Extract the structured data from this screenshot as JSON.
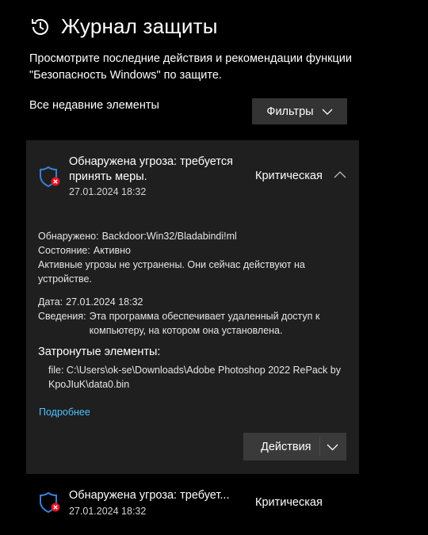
{
  "header": {
    "title": "Журнал защиты",
    "icon": "history-icon"
  },
  "description": "Просмотрите последние действия и рекомендации функции \"Безопасность Windows\" по защите.",
  "section_label": "Все недавние элементы",
  "filters": {
    "label": "Фильтры"
  },
  "threat_card": {
    "title": "Обнаружена угроза: требуется принять меры.",
    "date": "27.01.2024 18:32",
    "severity": "Критическая",
    "icon": "shield-threat-icon",
    "detected_label": "Обнаружено:",
    "detected_value": "Backdoor:Win32/Bladabindi!ml",
    "state_label": "Состояние:",
    "state_value": "Активно",
    "note": "Активные угрозы не устранены. Они сейчас действуют на устройстве.",
    "date_label": "Дата:",
    "date_value": "27.01.2024 18:32",
    "info_label": "Сведения:",
    "info_value": "Эта программа обеспечивает удаленный доступ к компьютеру, на котором она установлена.",
    "affected_heading": "Затронутые элементы:",
    "affected_file": "file: C:\\Users\\ok-se\\Downloads\\Adobe Photoshop 2022 RePack by KpoJIuK\\data0.bin",
    "more_link": "Подробнее",
    "actions_label": "Действия"
  },
  "threat_card_2": {
    "title": "Обнаружена угроза: требует...",
    "date": "27.01.2024 18:32",
    "severity": "Критическая",
    "icon": "shield-threat-icon"
  },
  "colors": {
    "background": "#000000",
    "card": "#1f1f1f",
    "button": "#333333",
    "link": "#4cc2ff",
    "shield": "#1e5bb8",
    "threat_badge": "#e81123"
  }
}
